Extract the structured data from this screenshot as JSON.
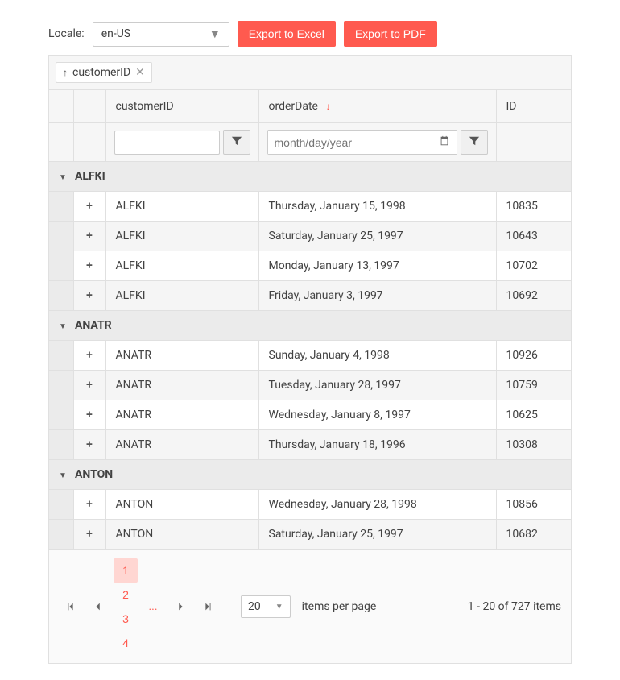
{
  "toolbar": {
    "locale_label": "Locale:",
    "locale_value": "en-US",
    "export_excel": "Export to Excel",
    "export_pdf": "Export to PDF"
  },
  "group_chip": {
    "field": "customerID"
  },
  "columns": {
    "customerID": "customerID",
    "orderDate": "orderDate",
    "id": "ID"
  },
  "filters": {
    "date_placeholder": "month/day/year"
  },
  "groups": [
    {
      "key": "ALFKI",
      "rows": [
        {
          "customerID": "ALFKI",
          "orderDate": "Thursday, January 15, 1998",
          "id": "10835"
        },
        {
          "customerID": "ALFKI",
          "orderDate": "Saturday, January 25, 1997",
          "id": "10643"
        },
        {
          "customerID": "ALFKI",
          "orderDate": "Monday, January 13, 1997",
          "id": "10702"
        },
        {
          "customerID": "ALFKI",
          "orderDate": "Friday, January 3, 1997",
          "id": "10692"
        }
      ]
    },
    {
      "key": "ANATR",
      "rows": [
        {
          "customerID": "ANATR",
          "orderDate": "Sunday, January 4, 1998",
          "id": "10926"
        },
        {
          "customerID": "ANATR",
          "orderDate": "Tuesday, January 28, 1997",
          "id": "10759"
        },
        {
          "customerID": "ANATR",
          "orderDate": "Wednesday, January 8, 1997",
          "id": "10625"
        },
        {
          "customerID": "ANATR",
          "orderDate": "Thursday, January 18, 1996",
          "id": "10308"
        }
      ]
    },
    {
      "key": "ANTON",
      "rows": [
        {
          "customerID": "ANTON",
          "orderDate": "Wednesday, January 28, 1998",
          "id": "10856"
        },
        {
          "customerID": "ANTON",
          "orderDate": "Saturday, January 25, 1997",
          "id": "10682"
        }
      ]
    }
  ],
  "pager": {
    "pages": [
      "1",
      "2",
      "3",
      "4"
    ],
    "ellipsis": "...",
    "active_page": "1",
    "page_size": "20",
    "per_page_label": "items per page",
    "info": "1 - 20 of 727 items"
  }
}
